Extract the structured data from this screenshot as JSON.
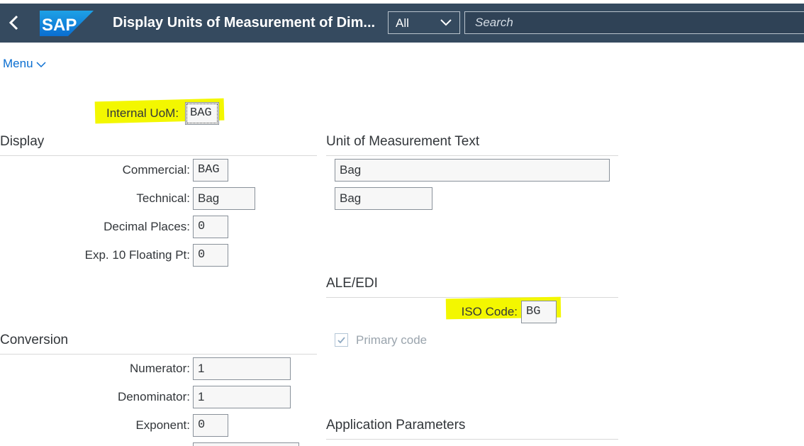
{
  "shell": {
    "back_icon": "chevron-left-icon",
    "logo_text": "SAP",
    "title": "Display Units of Measurement of Dim...",
    "scope": "All",
    "search_placeholder": "Search"
  },
  "menu": {
    "label": "Menu"
  },
  "internal_uom": {
    "label": "Internal UoM:",
    "value": "BAG"
  },
  "display": {
    "title": "Display",
    "commercial": {
      "label": "Commercial:",
      "value": "BAG"
    },
    "technical": {
      "label": "Technical:",
      "value": "Bag"
    },
    "decimal_places": {
      "label": "Decimal Places:",
      "value": "0"
    },
    "exp_floating": {
      "label": "Exp. 10 Floating Pt:",
      "value": "0"
    }
  },
  "uom_text": {
    "title": "Unit of Measurement Text",
    "long": "Bag",
    "short": "Bag"
  },
  "ale_edi": {
    "title": "ALE/EDI",
    "iso_code": {
      "label": "ISO Code:",
      "value": "BG"
    },
    "primary_code": {
      "label": "Primary code",
      "checked": true
    }
  },
  "conversion": {
    "title": "Conversion",
    "numerator": {
      "label": "Numerator:",
      "value": "1"
    },
    "denominator": {
      "label": "Denominator:",
      "value": "1"
    },
    "exponent": {
      "label": "Exponent:",
      "value": "0"
    }
  },
  "app_params": {
    "title": "Application Parameters"
  },
  "colors": {
    "shell": "#354a5f",
    "link": "#0a6ed1",
    "highlight": "#f3f700"
  }
}
